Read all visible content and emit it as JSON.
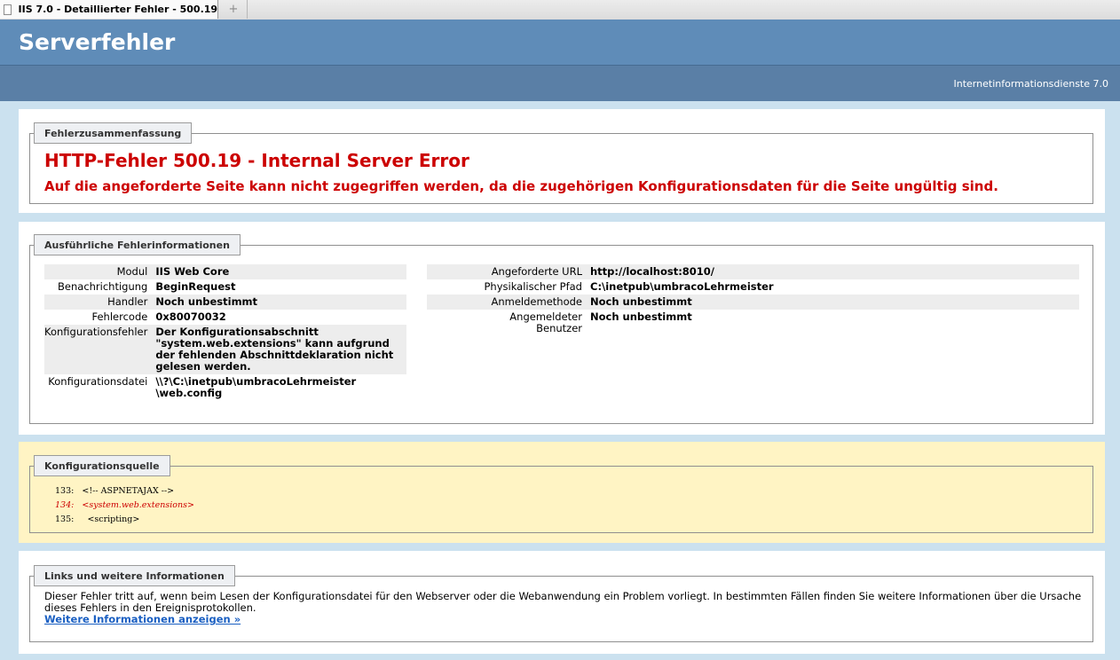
{
  "browser": {
    "tab_title": "IIS 7.0 - Detaillierter Fehler - 500.19 ...",
    "new_tab_symbol": "+"
  },
  "header": {
    "title": "Serverfehler",
    "product": "Internetinformationsdienste 7.0"
  },
  "summary": {
    "legend": "Fehlerzusammenfassung",
    "error_title": "HTTP-Fehler 500.19 - Internal Server Error",
    "error_subtitle": "Auf die angeforderte Seite kann nicht zugegriffen werden, da die zugehörigen Konfigurationsdaten für die Seite ungültig sind."
  },
  "details": {
    "legend": "Ausführliche Fehlerinformationen",
    "left": [
      {
        "key": "Modul",
        "value": "IIS Web Core"
      },
      {
        "key": "Benachrichtigung",
        "value": "BeginRequest"
      },
      {
        "key": "Handler",
        "value": "Noch unbestimmt"
      },
      {
        "key": "Fehlercode",
        "value": "0x80070032"
      },
      {
        "key": "Konfigurationsfehler",
        "value": "Der Konfigurationsabschnitt \"system.web.extensions\" kann aufgrund der fehlenden Abschnittdeklaration nicht gelesen werden."
      },
      {
        "key": "Konfigurationsdatei",
        "value": "\\\\?\\C:\\inetpub\\umbracoLehrmeister \\web.config"
      }
    ],
    "right": [
      {
        "key": "Angeforderte URL",
        "value": "http://localhost:8010/"
      },
      {
        "key": "Physikalischer Pfad",
        "value": "C:\\inetpub\\umbracoLehrmeister"
      },
      {
        "key": "Anmeldemethode",
        "value": "Noch unbestimmt"
      },
      {
        "key": "Angemeldeter Benutzer",
        "value": "Noch unbestimmt"
      }
    ]
  },
  "config_source": {
    "legend": "Konfigurationsquelle",
    "lines": [
      {
        "num": "133:",
        "code": "<!-- ASPNETAJAX -->"
      },
      {
        "num": "134:",
        "code": "<system.web.extensions>"
      },
      {
        "num": "135:",
        "code": "  <scripting>"
      }
    ]
  },
  "links": {
    "legend": "Links und weitere Informationen",
    "text": "Dieser Fehler tritt auf, wenn beim Lesen der Konfigurationsdatei für den Webserver oder die Webanwendung ein Problem vorliegt. In bestimmten Fällen finden Sie weitere Informationen über die Ursache dieses Fehlers in den Ereignisprotokollen.",
    "more_link": "Weitere Informationen anzeigen »"
  },
  "colors": {
    "header_bg": "#5f8cb8",
    "error_red": "#cc0000",
    "page_bg": "#cbe1ef",
    "source_bg": "#fff4c4",
    "link": "#1a5fc2"
  }
}
